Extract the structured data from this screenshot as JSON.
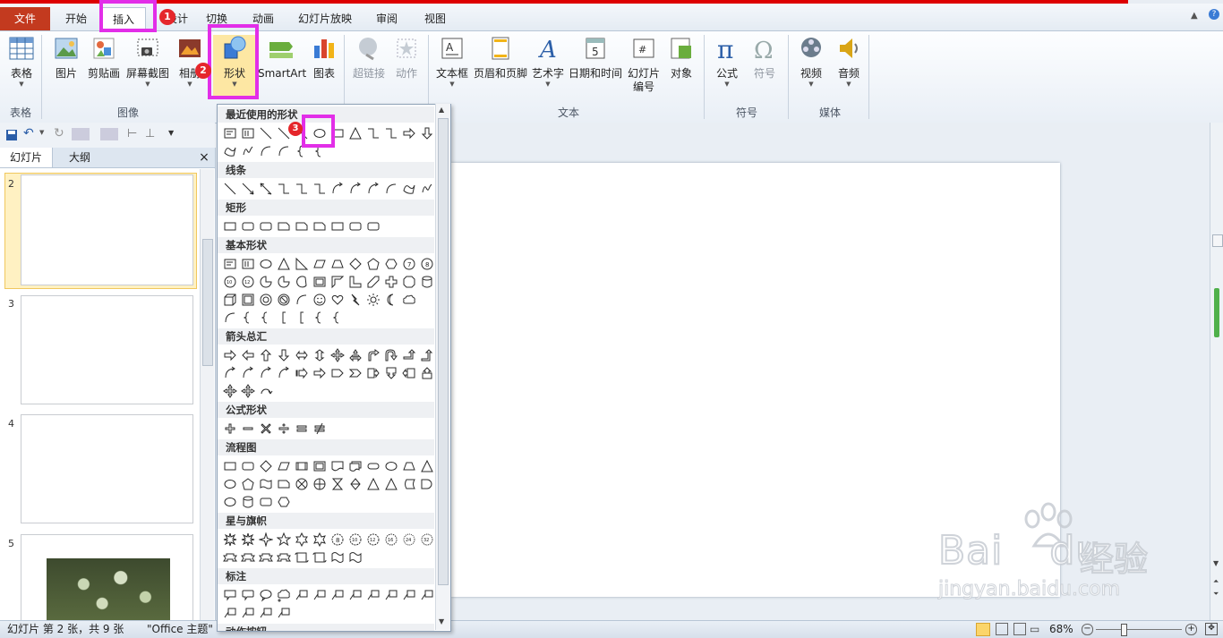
{
  "tabs": {
    "file": "文件",
    "home": "开始",
    "insert": "插入",
    "design": "设计",
    "transitions": "切换",
    "animations": "动画",
    "slideshow": "幻灯片放映",
    "review": "审阅",
    "view": "视图"
  },
  "badges": [
    "1",
    "2",
    "3"
  ],
  "ribbon": {
    "table": "表格",
    "picture": "图片",
    "clipart": "剪贴画",
    "screenshot": "屏幕截图",
    "album": "相册",
    "shapes": "形状",
    "smartart": "SmartArt",
    "chart": "图表",
    "hyperlink": "超链接",
    "action": "动作",
    "textbox": "文本框",
    "headerfooter": "页眉和页脚",
    "wordart": "艺术字",
    "datetime": "日期和时间",
    "slidenum_1": "幻灯片",
    "slidenum_2": "编号",
    "object": "对象",
    "equation": "公式",
    "symbol": "符号",
    "video": "视频",
    "audio": "音频"
  },
  "groups": {
    "table": "表格",
    "images": "图像",
    "text": "文本",
    "symbols": "符号",
    "media": "媒体"
  },
  "panel": {
    "slides_tab": "幻灯片",
    "outline_tab": "大纲",
    "close": "×",
    "numbers": [
      "2",
      "3",
      "4",
      "5"
    ]
  },
  "dropdown": {
    "recent": "最近使用的形状",
    "lines": "线条",
    "rect": "矩形",
    "basic": "基本形状",
    "arrows": "箭头总汇",
    "equation": "公式形状",
    "flowchart": "流程图",
    "stars": "星与旗帜",
    "callouts": "标注",
    "actions": "动作按钮"
  },
  "status": {
    "slide_info": "幻灯片 第 2 张，共 9 张",
    "theme": "\"Office 主题\"",
    "zoom": "68%"
  },
  "watermark": {
    "brand": "Bai",
    "brand2": "du",
    "cn": "经验",
    "url": "jingyan.baidu.com"
  },
  "colors": {
    "file_tab": "#c33a1f",
    "highlight": "#e22ee8",
    "badge": "#e5262b"
  }
}
